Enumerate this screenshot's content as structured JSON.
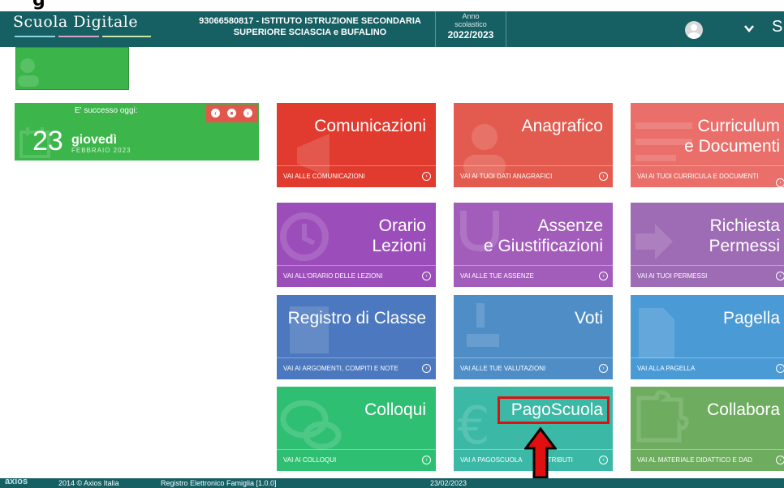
{
  "header": {
    "logo": "Scuola Digitale",
    "school_line1": "93066580817 - ISTITUTO ISTRUZIONE SECONDARIA",
    "school_line2": "SUPERIORE SCIASCIA e BUFALINO",
    "year_label_1": "Anno",
    "year_label_2": "scolastico",
    "year_value": "2022/2023",
    "trail_text": "S"
  },
  "date_card": {
    "header": "E' successo oggi:",
    "day_number": "23",
    "weekday": "giovedì",
    "month_year": "FEBBRAIO 2023"
  },
  "tiles": [
    {
      "title": "Comunicazioni",
      "footer": "VAI ALLE COMUNICAZIONI",
      "color": "#e03b2e"
    },
    {
      "title": "Anagrafico",
      "footer": "VAI AI TUOI DATI ANAGRAFICI",
      "color": "#e35b4f"
    },
    {
      "title_line1": "Curriculum",
      "title_line2": "e Documenti",
      "footer": "VAI AI TUOI CURRICULA E DOCUMENTI",
      "color": "#ea6f6a"
    },
    {
      "title_line1": "Orario",
      "title_line2": "Lezioni",
      "footer": "VAI ALL'ORARIO DELLE LEZIONI",
      "color": "#9b4dba"
    },
    {
      "title_line1": "Assenze",
      "title_line2": "e Giustificazioni",
      "footer": "VAI ALLE TUE ASSENZE",
      "color": "#a25dbb"
    },
    {
      "title_line1": "Richiesta",
      "title_line2": "Permessi",
      "footer": "VAI AI TUOI PERMESSI",
      "color": "#9e6bb5"
    },
    {
      "title": "Registro di Classe",
      "footer": "VAI AI ARGOMENTI, COMPITI E NOTE",
      "color": "#4b78be"
    },
    {
      "title": "Voti",
      "footer": "VAI ALLE TUE VALUTAZIONI",
      "color": "#4f8dc7"
    },
    {
      "title": "Pagella",
      "footer": "VAI ALLA PAGELLA",
      "color": "#4a9ad6"
    },
    {
      "title": "Colloqui",
      "footer": "VAI AI COLLOQUI",
      "color": "#2fbf73"
    },
    {
      "title": "PagoScuola",
      "footer": "VAI A PAGOSCUOLA",
      "footer_tail": "NTRIBUTI",
      "color": "#3cb9a6"
    },
    {
      "title": "Collabora",
      "footer": "VAI AL MATERIALE DIDATTICO E DAD",
      "color": "#6ead5f"
    }
  ],
  "footer": {
    "brand": "axios",
    "copyright": "2014 © Axios Italia",
    "app": "Registro Elettronico Famiglia [1.0.0]",
    "date": "23/02/2023"
  },
  "colors": {
    "navbar": "#165f63",
    "highlight": "#e01010"
  }
}
